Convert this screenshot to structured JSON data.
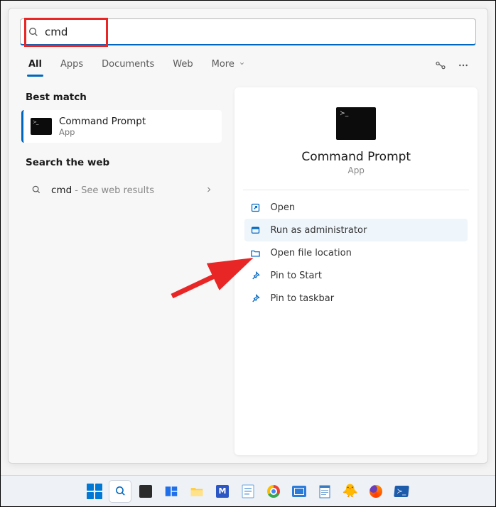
{
  "search": {
    "value": "cmd"
  },
  "tabs": {
    "all": "All",
    "apps": "Apps",
    "documents": "Documents",
    "web": "Web",
    "more": "More"
  },
  "left": {
    "best_match_label": "Best match",
    "best_match_item": {
      "title": "Command Prompt",
      "subtitle": "App"
    },
    "search_web_label": "Search the web",
    "search_web_item": {
      "query": "cmd",
      "hint": " - See web results"
    }
  },
  "preview": {
    "title": "Command Prompt",
    "subtitle": "App",
    "actions": {
      "open": "Open",
      "run_admin": "Run as administrator",
      "open_location": "Open file location",
      "pin_start": "Pin to Start",
      "pin_taskbar": "Pin to taskbar"
    }
  }
}
